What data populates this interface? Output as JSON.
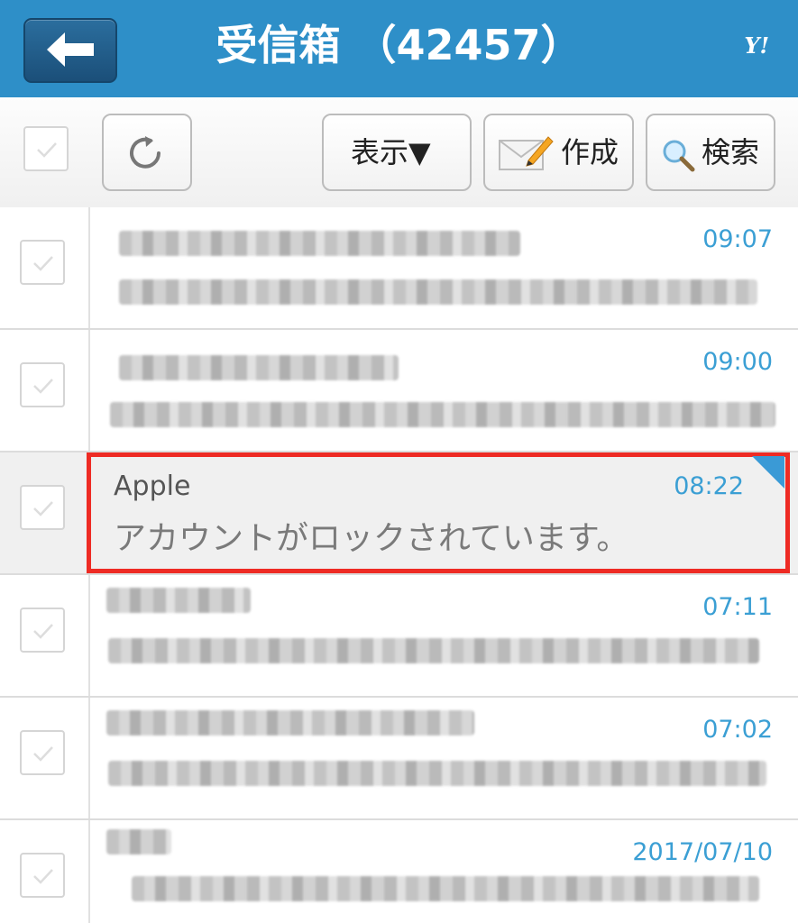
{
  "header": {
    "title": "受信箱 （42457）",
    "logo": "Y!"
  },
  "toolbar": {
    "display_label": "表示▼",
    "compose_label": "作成",
    "search_label": "検索"
  },
  "messages": [
    {
      "time": "09:07"
    },
    {
      "time": "09:00"
    },
    {
      "sender": "Apple",
      "subject": "アカウントがロックされています。",
      "time": "08:22"
    },
    {
      "time": "07:11"
    },
    {
      "time": "07:02"
    },
    {
      "time": "2017/07/10"
    }
  ],
  "colors": {
    "header_bg": "#2e8fc8",
    "accent": "#3b9fd4",
    "highlight": "#ee2b24"
  },
  "icons": [
    "back-arrow-icon",
    "refresh-icon",
    "envelope-pencil-icon",
    "magnifier-icon",
    "check-icon"
  ]
}
